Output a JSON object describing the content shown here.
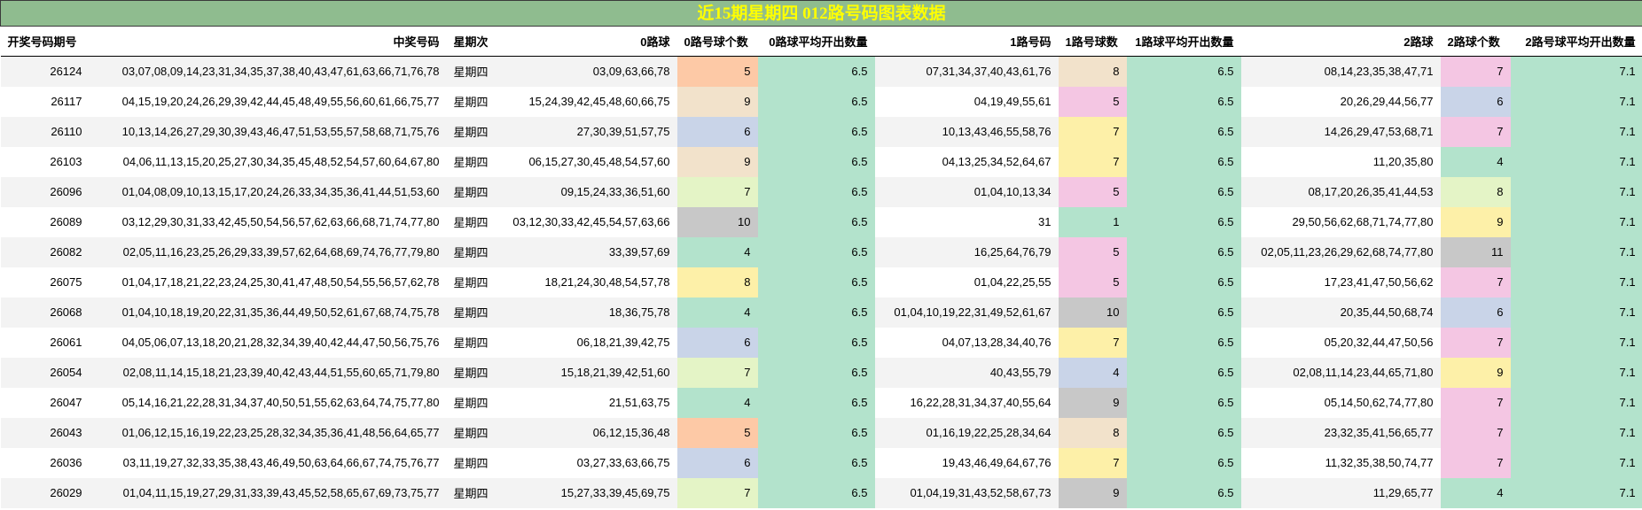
{
  "title": "近15期星期四 012路号码图表数据",
  "headers": [
    "开奖号码期号",
    "中奖号码",
    "星期次",
    "0路球",
    "0路号球个数",
    "0路球平均开出数量",
    "1路号码",
    "1路号球数",
    "1路球平均开出数量",
    "2路球",
    "2路球个数",
    "2路号球平均开出数量"
  ],
  "count_colors": {
    "1": "#b3e3cc",
    "4": "#b3e3cc",
    "5": "#f4c6e3",
    "6": "#c9d4e8",
    "7": "#fdf0a8",
    "8": "#f2e2cb",
    "9": "#f2e2cb",
    "10": "#c8c8c8",
    "11": "#c8c8c8"
  },
  "rows": [
    {
      "issue": "26124",
      "numbers": "03,07,08,09,14,23,31,34,35,37,38,40,43,47,61,63,66,71,76,78",
      "weekday": "星期四",
      "r0": "03,09,63,66,78",
      "c0": "5",
      "a0": "6.5",
      "r1": "07,31,34,37,40,43,61,76",
      "c1": "8",
      "a1": "6.5",
      "r2": "08,14,23,35,38,47,71",
      "c2": "7",
      "a2": "7.1",
      "c0_color": "#fdc9a6",
      "c1_color": "#f2e2cb",
      "c2_color": "#f4c6e3"
    },
    {
      "issue": "26117",
      "numbers": "04,15,19,20,24,26,29,39,42,44,45,48,49,55,56,60,61,66,75,77",
      "weekday": "星期四",
      "r0": "15,24,39,42,45,48,60,66,75",
      "c0": "9",
      "a0": "6.5",
      "r1": "04,19,49,55,61",
      "c1": "5",
      "a1": "6.5",
      "r2": "20,26,29,44,56,77",
      "c2": "6",
      "a2": "7.1",
      "c0_color": "#f2e2cb",
      "c1_color": "#f4c6e3",
      "c2_color": "#c9d4e8"
    },
    {
      "issue": "26110",
      "numbers": "10,13,14,26,27,29,30,39,43,46,47,51,53,55,57,58,68,71,75,76",
      "weekday": "星期四",
      "r0": "27,30,39,51,57,75",
      "c0": "6",
      "a0": "6.5",
      "r1": "10,13,43,46,55,58,76",
      "c1": "7",
      "a1": "6.5",
      "r2": "14,26,29,47,53,68,71",
      "c2": "7",
      "a2": "7.1",
      "c0_color": "#c9d4e8",
      "c1_color": "#fdf0a8",
      "c2_color": "#f4c6e3"
    },
    {
      "issue": "26103",
      "numbers": "04,06,11,13,15,20,25,27,30,34,35,45,48,52,54,57,60,64,67,80",
      "weekday": "星期四",
      "r0": "06,15,27,30,45,48,54,57,60",
      "c0": "9",
      "a0": "6.5",
      "r1": "04,13,25,34,52,64,67",
      "c1": "7",
      "a1": "6.5",
      "r2": "11,20,35,80",
      "c2": "4",
      "a2": "7.1",
      "c0_color": "#f2e2cb",
      "c1_color": "#fdf0a8",
      "c2_color": "#b3e3cc"
    },
    {
      "issue": "26096",
      "numbers": "01,04,08,09,10,13,15,17,20,24,26,33,34,35,36,41,44,51,53,60",
      "weekday": "星期四",
      "r0": "09,15,24,33,36,51,60",
      "c0": "7",
      "a0": "6.5",
      "r1": "01,04,10,13,34",
      "c1": "5",
      "a1": "6.5",
      "r2": "08,17,20,26,35,41,44,53",
      "c2": "8",
      "a2": "7.1",
      "c0_color": "#e4f4c6",
      "c1_color": "#f4c6e3",
      "c2_color": "#e4f4c6"
    },
    {
      "issue": "26089",
      "numbers": "03,12,29,30,31,33,42,45,50,54,56,57,62,63,66,68,71,74,77,80",
      "weekday": "星期四",
      "r0": "03,12,30,33,42,45,54,57,63,66",
      "c0": "10",
      "a0": "6.5",
      "r1": "31",
      "c1": "1",
      "a1": "6.5",
      "r2": "29,50,56,62,68,71,74,77,80",
      "c2": "9",
      "a2": "7.1",
      "c0_color": "#c8c8c8",
      "c1_color": "#b3e3cc",
      "c2_color": "#fdf0a8"
    },
    {
      "issue": "26082",
      "numbers": "02,05,11,16,23,25,26,29,33,39,57,62,64,68,69,74,76,77,79,80",
      "weekday": "星期四",
      "r0": "33,39,57,69",
      "c0": "4",
      "a0": "6.5",
      "r1": "16,25,64,76,79",
      "c1": "5",
      "a1": "6.5",
      "r2": "02,05,11,23,26,29,62,68,74,77,80",
      "c2": "11",
      "a2": "7.1",
      "c0_color": "#b3e3cc",
      "c1_color": "#f4c6e3",
      "c2_color": "#c8c8c8"
    },
    {
      "issue": "26075",
      "numbers": "01,04,17,18,21,22,23,24,25,30,41,47,48,50,54,55,56,57,62,78",
      "weekday": "星期四",
      "r0": "18,21,24,30,48,54,57,78",
      "c0": "8",
      "a0": "6.5",
      "r1": "01,04,22,25,55",
      "c1": "5",
      "a1": "6.5",
      "r2": "17,23,41,47,50,56,62",
      "c2": "7",
      "a2": "7.1",
      "c0_color": "#fdf0a8",
      "c1_color": "#f4c6e3",
      "c2_color": "#f4c6e3"
    },
    {
      "issue": "26068",
      "numbers": "01,04,10,18,19,20,22,31,35,36,44,49,50,52,61,67,68,74,75,78",
      "weekday": "星期四",
      "r0": "18,36,75,78",
      "c0": "4",
      "a0": "6.5",
      "r1": "01,04,10,19,22,31,49,52,61,67",
      "c1": "10",
      "a1": "6.5",
      "r2": "20,35,44,50,68,74",
      "c2": "6",
      "a2": "7.1",
      "c0_color": "#b3e3cc",
      "c1_color": "#c8c8c8",
      "c2_color": "#c9d4e8"
    },
    {
      "issue": "26061",
      "numbers": "04,05,06,07,13,18,20,21,28,32,34,39,40,42,44,47,50,56,75,76",
      "weekday": "星期四",
      "r0": "06,18,21,39,42,75",
      "c0": "6",
      "a0": "6.5",
      "r1": "04,07,13,28,34,40,76",
      "c1": "7",
      "a1": "6.5",
      "r2": "05,20,32,44,47,50,56",
      "c2": "7",
      "a2": "7.1",
      "c0_color": "#c9d4e8",
      "c1_color": "#fdf0a8",
      "c2_color": "#f4c6e3"
    },
    {
      "issue": "26054",
      "numbers": "02,08,11,14,15,18,21,23,39,40,42,43,44,51,55,60,65,71,79,80",
      "weekday": "星期四",
      "r0": "15,18,21,39,42,51,60",
      "c0": "7",
      "a0": "6.5",
      "r1": "40,43,55,79",
      "c1": "4",
      "a1": "6.5",
      "r2": "02,08,11,14,23,44,65,71,80",
      "c2": "9",
      "a2": "7.1",
      "c0_color": "#e4f4c6",
      "c1_color": "#c9d4e8",
      "c2_color": "#fdf0a8"
    },
    {
      "issue": "26047",
      "numbers": "05,14,16,21,22,28,31,34,37,40,50,51,55,62,63,64,74,75,77,80",
      "weekday": "星期四",
      "r0": "21,51,63,75",
      "c0": "4",
      "a0": "6.5",
      "r1": "16,22,28,31,34,37,40,55,64",
      "c1": "9",
      "a1": "6.5",
      "r2": "05,14,50,62,74,77,80",
      "c2": "7",
      "a2": "7.1",
      "c0_color": "#b3e3cc",
      "c1_color": "#c8c8c8",
      "c2_color": "#f4c6e3"
    },
    {
      "issue": "26043",
      "numbers": "01,06,12,15,16,19,22,23,25,28,32,34,35,36,41,48,56,64,65,77",
      "weekday": "星期四",
      "r0": "06,12,15,36,48",
      "c0": "5",
      "a0": "6.5",
      "r1": "01,16,19,22,25,28,34,64",
      "c1": "8",
      "a1": "6.5",
      "r2": "23,32,35,41,56,65,77",
      "c2": "7",
      "a2": "7.1",
      "c0_color": "#fdc9a6",
      "c1_color": "#f2e2cb",
      "c2_color": "#f4c6e3"
    },
    {
      "issue": "26036",
      "numbers": "03,11,19,27,32,33,35,38,43,46,49,50,63,64,66,67,74,75,76,77",
      "weekday": "星期四",
      "r0": "03,27,33,63,66,75",
      "c0": "6",
      "a0": "6.5",
      "r1": "19,43,46,49,64,67,76",
      "c1": "7",
      "a1": "6.5",
      "r2": "11,32,35,38,50,74,77",
      "c2": "7",
      "a2": "7.1",
      "c0_color": "#c9d4e8",
      "c1_color": "#fdf0a8",
      "c2_color": "#f4c6e3"
    },
    {
      "issue": "26029",
      "numbers": "01,04,11,15,19,27,29,31,33,39,43,45,52,58,65,67,69,73,75,77",
      "weekday": "星期四",
      "r0": "15,27,33,39,45,69,75",
      "c0": "7",
      "a0": "6.5",
      "r1": "01,04,19,31,43,52,58,67,73",
      "c1": "9",
      "a1": "6.5",
      "r2": "11,29,65,77",
      "c2": "4",
      "a2": "7.1",
      "c0_color": "#e4f4c6",
      "c1_color": "#c8c8c8",
      "c2_color": "#b3e3cc"
    }
  ]
}
